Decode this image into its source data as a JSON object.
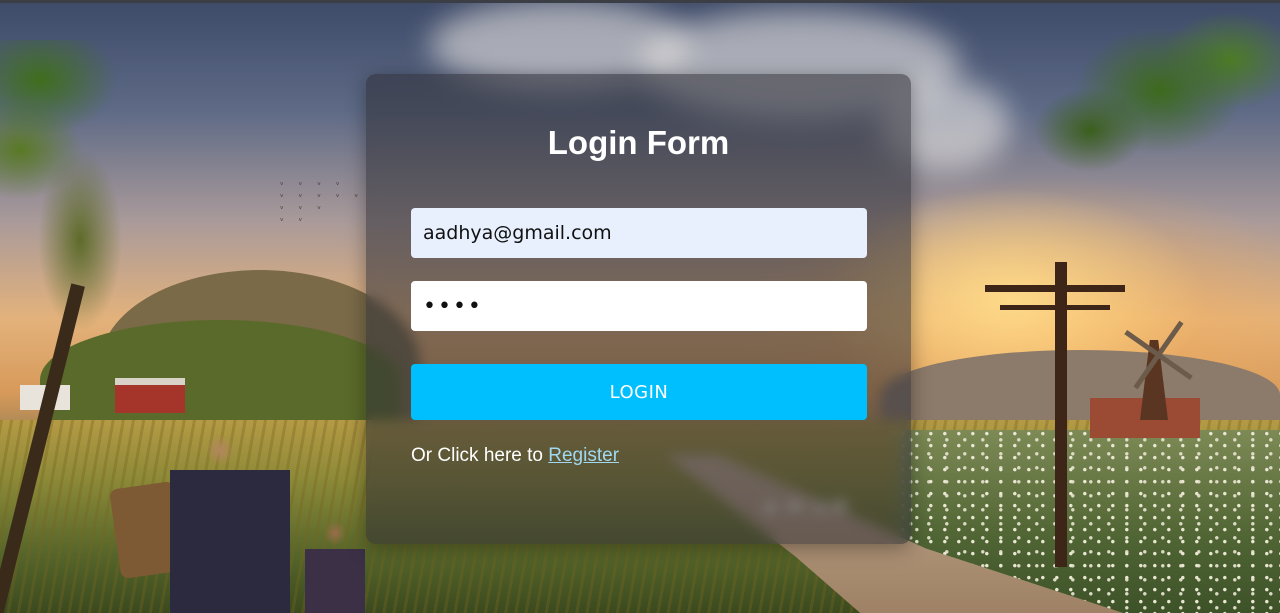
{
  "form": {
    "title": "Login Form",
    "email_value": "aadhya@gmail.com",
    "password_value": "••••",
    "login_label": "LOGIN",
    "register_prefix": "Or Click here to",
    "register_link": "Register"
  },
  "colors": {
    "button": "#00bfff",
    "email_field_bg": "#e8f0fe",
    "card_bg": "rgba(46,46,52,0.55)"
  }
}
